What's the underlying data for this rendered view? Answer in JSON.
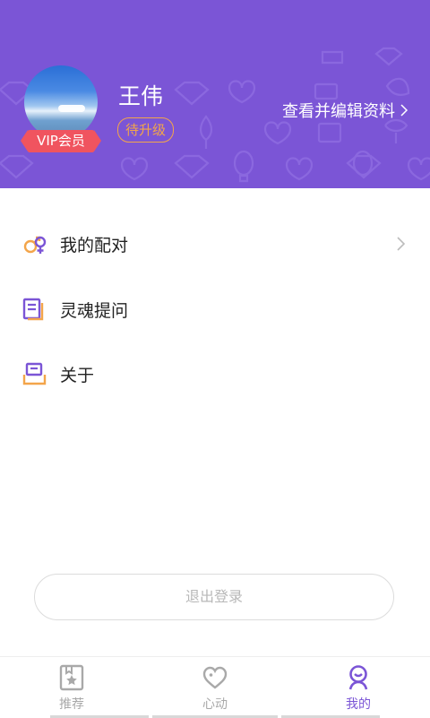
{
  "profile": {
    "username": "王伟",
    "vip_label": "VIP会员",
    "level_label": "待升级",
    "edit_link_label": "查看并编辑资料"
  },
  "menu": {
    "items": [
      {
        "label": "我的配对",
        "icon": "gender-pair-icon"
      },
      {
        "label": "灵魂提问",
        "icon": "question-doc-icon"
      },
      {
        "label": "关于",
        "icon": "about-icon"
      }
    ]
  },
  "logout_label": "退出登录",
  "tabbar": {
    "tabs": [
      {
        "label": "推荐",
        "icon": "bookmark-star-icon"
      },
      {
        "label": "心动",
        "icon": "heart-icon"
      },
      {
        "label": "我的",
        "icon": "user-icon"
      }
    ],
    "active_index": 2
  },
  "colors": {
    "brand_purple": "#7b55d6",
    "accent_orange": "#f3a54a",
    "vip_red": "#f0545f",
    "inactive_gray": "#a9a9a9"
  }
}
